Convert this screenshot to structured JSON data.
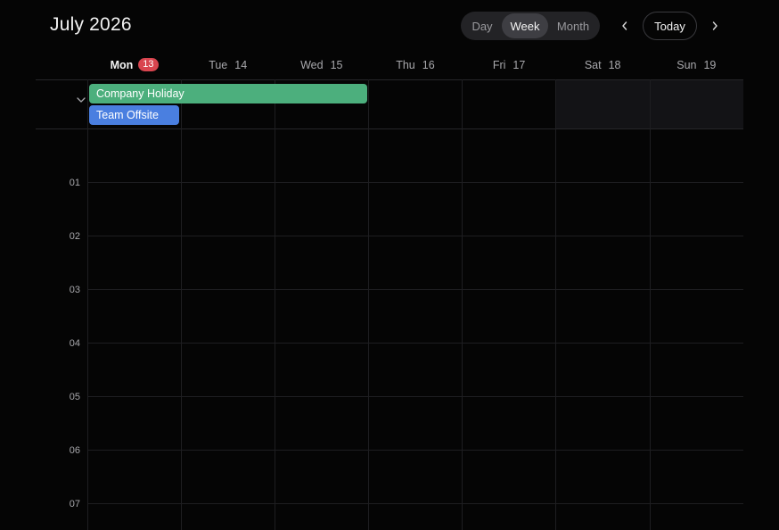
{
  "header": {
    "title": "July 2026",
    "views": [
      "Day",
      "Week",
      "Month"
    ],
    "active_view": "Week",
    "today_label": "Today",
    "prev_icon": "chevron-left-icon",
    "next_icon": "chevron-right-icon"
  },
  "days": [
    {
      "name": "Mon",
      "num": "13",
      "today": true
    },
    {
      "name": "Tue",
      "num": "14",
      "today": false
    },
    {
      "name": "Wed",
      "num": "15",
      "today": false
    },
    {
      "name": "Thu",
      "num": "16",
      "today": false
    },
    {
      "name": "Fri",
      "num": "17",
      "today": false
    },
    {
      "name": "Sat",
      "num": "18",
      "today": false
    },
    {
      "name": "Sun",
      "num": "19",
      "today": false
    }
  ],
  "allday": {
    "toggle_icon": "chevron-down-icon",
    "events": [
      {
        "title": "Company Holiday",
        "color": "#4caf7d",
        "start_day": "Mon",
        "end_day": "Wed"
      },
      {
        "title": "Team Offsite",
        "color": "#4a7fe0",
        "start_day": "Mon",
        "end_day": "Mon"
      }
    ]
  },
  "hours": [
    "01",
    "02",
    "03",
    "04",
    "05",
    "06",
    "07"
  ],
  "colors": {
    "background": "#050505",
    "today_badge": "#d9454f",
    "active_view_bg": "#3e3e43"
  }
}
